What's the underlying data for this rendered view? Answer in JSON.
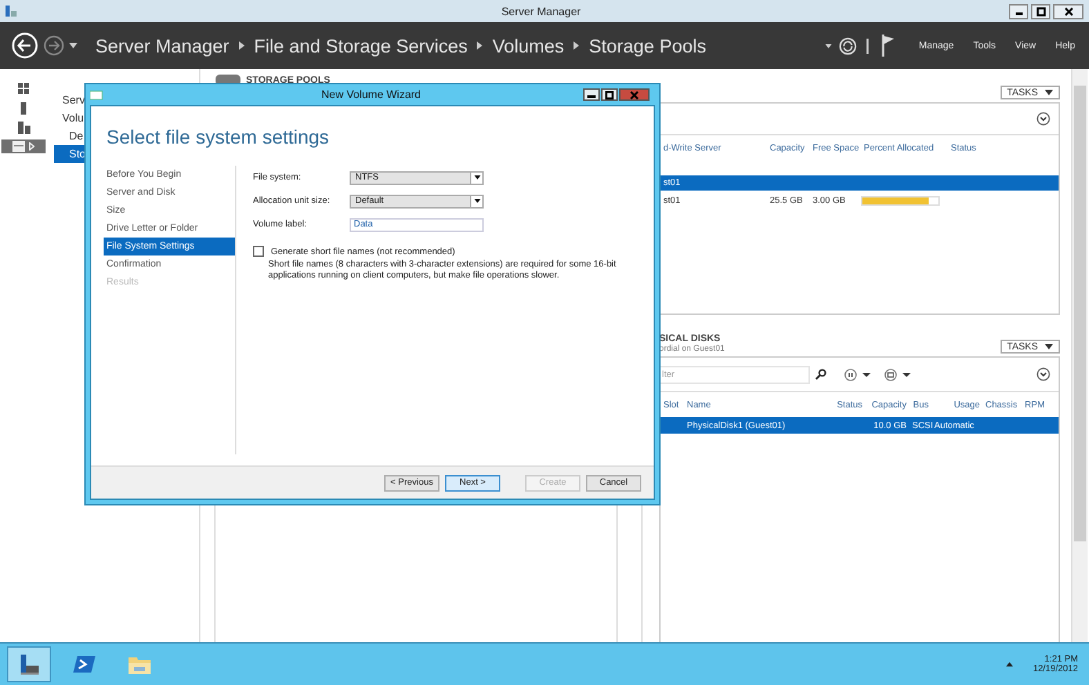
{
  "window": {
    "title": "Server Manager"
  },
  "navigation": {
    "breadcrumb": [
      "Server Manager",
      "File and Storage Services",
      "Volumes",
      "Storage Pools"
    ],
    "menu": [
      "Manage",
      "Tools",
      "View",
      "Help"
    ]
  },
  "icon_strip": [
    {
      "selected": false
    },
    {
      "selected": false
    },
    {
      "selected": false
    },
    {
      "selected": true
    }
  ],
  "sidebar": {
    "items": [
      {
        "label": "Serv",
        "selected": false
      },
      {
        "label": "Volu",
        "selected": false,
        "children": [
          {
            "label": "De",
            "selected": false
          },
          {
            "label": "Sto",
            "selected": true
          }
        ]
      }
    ]
  },
  "storage_pools": {
    "title": "STORAGE POOLS",
    "tasks": "TASKS",
    "columns": [
      "d-Write Server",
      "Capacity",
      "Free Space",
      "Percent Allocated",
      "Status"
    ],
    "rows": [
      {
        "kind": "group",
        "server": "st01",
        "selected": true
      },
      {
        "kind": "pool",
        "server": "st01",
        "capacity": "25.5 GB",
        "free_space": "3.00 GB",
        "level": 0.88,
        "selected": false
      }
    ]
  },
  "physical_disks": {
    "title": "SICAL DISKS",
    "subtitle": "ordial on Guest01",
    "tasks": "TASKS",
    "filter": {
      "placeholder": "lter"
    },
    "columns": [
      "Slot",
      "Name",
      "Status",
      "Capacity",
      "Bus",
      "Usage",
      "Chassis",
      "RPM"
    ],
    "rows": [
      {
        "name": "PhysicalDisk1 (Guest01)",
        "capacity": "10.0 GB",
        "bus": "SCSI",
        "usage": "Automatic",
        "selected": true
      }
    ]
  },
  "wizard": {
    "title": "New Volume Wizard",
    "heading": "Select file system settings",
    "steps": [
      {
        "label": "Before You Begin",
        "selected": false,
        "disabled": false
      },
      {
        "label": "Server and Disk",
        "selected": false,
        "disabled": false
      },
      {
        "label": "Size",
        "selected": false,
        "disabled": false
      },
      {
        "label": "Drive Letter or Folder",
        "selected": false,
        "disabled": false
      },
      {
        "label": "File System Settings",
        "selected": true,
        "disabled": false
      },
      {
        "label": "Confirmation",
        "selected": false,
        "disabled": false
      },
      {
        "label": "Results",
        "selected": false,
        "disabled": true
      }
    ],
    "fields": [
      {
        "kind": "dropdown",
        "label": "File system:",
        "value": "NTFS"
      },
      {
        "kind": "dropdown",
        "label": "Allocation unit size:",
        "value": "Default"
      },
      {
        "kind": "text",
        "label": "Volume label:",
        "value": "Data"
      }
    ],
    "short_names": {
      "label": "Generate short file names (not recommended)",
      "checked": false,
      "note": "Short file names (8 characters with 3-character extensions) are required for some 16-bit applications running on client computers, but make file operations slower."
    },
    "buttons": [
      {
        "label": "< Previous",
        "default": false,
        "disabled": false
      },
      {
        "label": "Next >",
        "default": true,
        "disabled": false
      },
      {
        "label": "Create",
        "default": false,
        "disabled": true
      },
      {
        "label": "Cancel",
        "default": false,
        "disabled": false
      }
    ]
  },
  "taskbar": {
    "apps": [
      {
        "selected": true
      },
      {
        "selected": false
      },
      {
        "selected": false
      }
    ],
    "time": "1:21 PM",
    "date": "12/19/2012"
  }
}
